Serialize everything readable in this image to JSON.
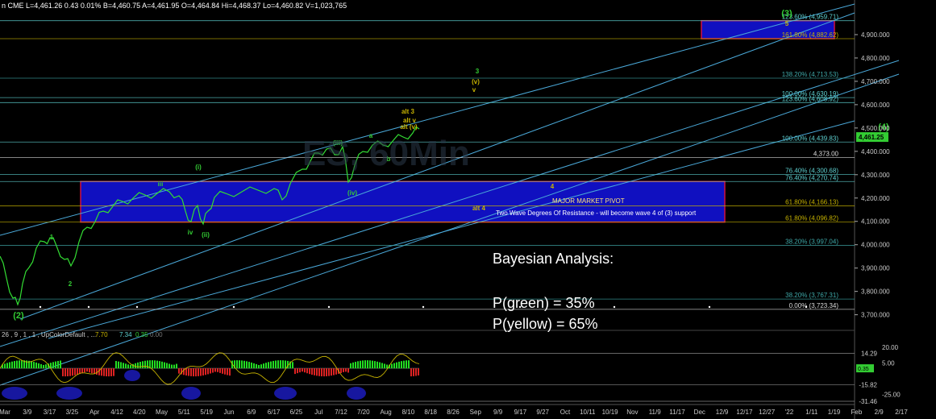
{
  "header": {
    "text": "n CME  L=4,461.26  0.43  0.01%  B=4,460.75  A=4,461.95  O=4,464.84  Hi=4,468.37  Lo=4,460.82  V=1,023,765"
  },
  "watermark": "ES, 60Min",
  "chart_data": {
    "type": "line",
    "price_axis": {
      "ticks": [
        "4,900.000",
        "4,800.000",
        "4,700.000",
        "4,600.000",
        "4,500.000",
        "4,400.000",
        "4,300.000",
        "4,200.000",
        "4,100.000",
        "4,000.000",
        "3,900.000",
        "3,800.000",
        "3,700.000"
      ],
      "tick_values": [
        4900,
        4800,
        4700,
        4600,
        4500,
        4400,
        4300,
        4200,
        4100,
        4000,
        3900,
        3800,
        3700
      ],
      "ylim": [
        3640,
        5000
      ],
      "current_price": "4,461.25"
    },
    "date_axis": {
      "labels": [
        "Mar",
        "3/9",
        "3/17",
        "3/25",
        "Apr",
        "4/12",
        "4/20",
        "May",
        "5/11",
        "5/19",
        "Jun",
        "6/9",
        "6/17",
        "6/25",
        "Jul",
        "7/12",
        "7/20",
        "Aug",
        "8/10",
        "8/18",
        "8/26",
        "Sep",
        "9/9",
        "9/17",
        "9/27",
        "Oct",
        "10/11",
        "10/19",
        "Nov",
        "11/9",
        "11/17",
        "Dec",
        "12/9",
        "12/17",
        "12/27",
        "'22",
        "1/11",
        "1/19",
        "Feb",
        "2/9",
        "2/17"
      ]
    },
    "levels": [
      {
        "label": "123.60% (4,959.71)",
        "value": 4959.71,
        "color": "#5fd3d3"
      },
      {
        "label": "161.80% (4,882.62)",
        "value": 4882.62,
        "color": "#c8b400"
      },
      {
        "label": "138.20% (4,713.53)",
        "value": 4713.53,
        "color": "#3fa9a9"
      },
      {
        "label": "100.00% (4,630.19)",
        "value": 4630.19,
        "color": "#5fd3d3"
      },
      {
        "label": "123.60% (4,608.92)",
        "value": 4608.92,
        "color": "#5fd3d3"
      },
      {
        "label": "100.00% (4,439.83)",
        "value": 4439.83,
        "color": "#5fd3d3"
      },
      {
        "label": "4,373.00",
        "value": 4373.0,
        "color": "#dddddd"
      },
      {
        "label": "76.40% (4,300.68)",
        "value": 4300.68,
        "color": "#5fd3d3"
      },
      {
        "label": "76.40% (4,270.74)",
        "value": 4270.74,
        "color": "#5fd3d3"
      },
      {
        "label": "61.80% (4,166.13)",
        "value": 4166.13,
        "color": "#c8b400"
      },
      {
        "label": "61.80% (4,096.82)",
        "value": 4096.82,
        "color": "#c8b400"
      },
      {
        "label": "38.20% (3,997.04)",
        "value": 3997.04,
        "color": "#3fa9a9"
      },
      {
        "label": "38.20% (3,767.31)",
        "value": 3767.31,
        "color": "#3fa9a9"
      },
      {
        "label": "0.00% (3,723.34)",
        "value": 3723.34,
        "color": "#dddddd"
      }
    ],
    "zones": [
      {
        "name": "upper-target",
        "from": 4882.62,
        "to": 4959.71,
        "color": "#1010c0"
      },
      {
        "name": "pivot",
        "from": 4096.82,
        "to": 4270.74,
        "color": "#1010c0"
      }
    ],
    "zone_texts": {
      "pivot_title": "MAJOR MARKET PIVOT",
      "pivot_sub": "Two Wave Degrees Of Resistance - will become wave 4 of (3) support"
    },
    "wave_labels": [
      {
        "text": "(3)",
        "color": "#33cc33"
      },
      {
        "text": "5",
        "color": "#c8b400"
      },
      {
        "text": "3",
        "color": "#33cc33"
      },
      {
        "text": "(v)",
        "color": "#c8b400"
      },
      {
        "text": "v",
        "color": "#c8b400"
      },
      {
        "text": "alt 3",
        "color": "#c8b400"
      },
      {
        "text": "alt v",
        "color": "#c8b400"
      },
      {
        "text": "alt (v)",
        "color": "#c8b400"
      },
      {
        "text": "(4)",
        "color": "#33cc33"
      },
      {
        "text": "4",
        "color": "#c8b400"
      },
      {
        "text": "alt 4",
        "color": "#c8b400"
      },
      {
        "text": "iii",
        "color": "#33cc33"
      },
      {
        "text": "(i)",
        "color": "#33cc33"
      },
      {
        "text": "iv",
        "color": "#33cc33"
      },
      {
        "text": "(ii)",
        "color": "#33cc33"
      },
      {
        "text": "(iii)",
        "color": "#33cc33"
      },
      {
        "text": "(iv)",
        "color": "#33cc33"
      },
      {
        "text": "a",
        "color": "#33cc33"
      },
      {
        "text": "b",
        "color": "#33cc33"
      },
      {
        "text": "1",
        "color": "#33cc33"
      },
      {
        "text": "2",
        "color": "#33cc33"
      },
      {
        "text": "(2)",
        "color": "#33cc33"
      }
    ],
    "annotation": {
      "title": "Bayesian Analysis:",
      "green": "P(green) = 35%",
      "yellow": "P(yellow) = 65%"
    },
    "oscillator": {
      "header": "26 , 9 , 1 , 1 , UpColorDefault , ...",
      "readings": [
        "7.70",
        "7.34",
        "0.35",
        "0.00"
      ],
      "reading_colors": [
        "#c8b400",
        "#5fd3d3",
        "#33cc33",
        "#777777"
      ],
      "ticks": [
        "20.00",
        "5.00",
        "-25.00"
      ],
      "tick_values": [
        20,
        5,
        -25
      ],
      "levels": [
        "14.29",
        "-15.82",
        "-31.46"
      ],
      "level_values": [
        14.29,
        -15.82,
        -31.46
      ],
      "current": "0.35",
      "ylim": [
        -33,
        27
      ]
    }
  }
}
